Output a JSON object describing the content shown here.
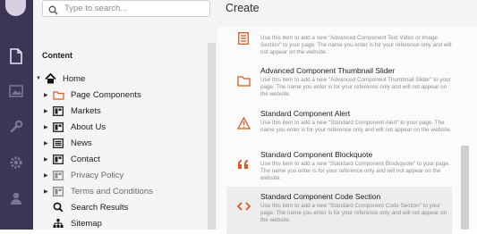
{
  "search": {
    "placeholder": "Type to search..."
  },
  "tree": {
    "title": "Content",
    "nodes": [
      {
        "label": "Home",
        "icon": "home-icon"
      },
      {
        "label": "Page Components",
        "icon": "folder-icon"
      },
      {
        "label": "Markets",
        "icon": "layout-icon"
      },
      {
        "label": "About Us",
        "icon": "layout-icon"
      },
      {
        "label": "News",
        "icon": "list-icon"
      },
      {
        "label": "Contact",
        "icon": "layout-icon"
      },
      {
        "label": "Privacy Policy",
        "icon": "layout-icon"
      },
      {
        "label": "Terms and Conditions",
        "icon": "layout-icon"
      },
      {
        "label": "Search Results",
        "icon": "search-icon"
      },
      {
        "label": "Sitemap",
        "icon": "sitemap-icon"
      }
    ]
  },
  "panel": {
    "title": "Create",
    "items": [
      {
        "name": "",
        "desc": "Use this item to add a new \"Advanced Component Text Video or Image Section\" to your page. The name you enter is for your reference only and will not appear on the website.",
        "icon": "section-icon"
      },
      {
        "name": "Advanced Component Thumbnail Slider",
        "desc": "Use this item to add a new \"Advanced Component Thumbnail Slider\" to your page. The name you enter is for your reference only and will not appear on the website.",
        "icon": "folder-icon"
      },
      {
        "name": "Standard Component Alert",
        "desc": "Use this item to add a new \"Standard Component Alert\" to your page. The name you enter is for your reference only and will not appear on the website.",
        "icon": "alert-icon"
      },
      {
        "name": "Standard Component Blockquote",
        "desc": "Use this item to add a new \"Standard Component Blockquote\" to your page. The name you enter is for your reference only and will not appear on the website.",
        "icon": "quote-icon"
      },
      {
        "name": "Standard Component Code Section",
        "desc": "Use this item to add a new \"Standard Component Code Section\" to your page. The name you enter is for your reference only and will not appear on the website.",
        "icon": "code-icon"
      }
    ]
  },
  "colors": {
    "rail": "#3c3656",
    "accent": "#e0581f"
  }
}
